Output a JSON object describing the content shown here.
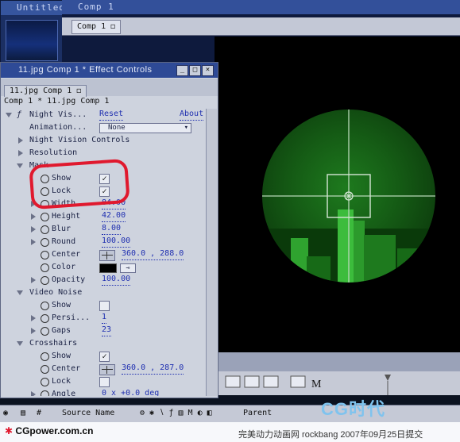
{
  "project": {
    "title": "Untitled"
  },
  "comp_window": {
    "title": "Comp 1",
    "tab_label": "Comp 1"
  },
  "effect_controls": {
    "title": "11.jpg Comp 1 * Effect Controls",
    "tab_label": "11.jpg Comp 1",
    "subtitle": "Comp 1 * 11.jpg Comp 1",
    "effect_name": "Night Vis...",
    "reset_label": "Reset",
    "about_label": "About",
    "animation_label": "Animation...",
    "animation_value": "None",
    "rows": [
      {
        "label": "Night Vision Controls"
      },
      {
        "label": "Resolution"
      },
      {
        "label": "Mask"
      },
      {
        "label": "Show"
      },
      {
        "label": "Lock"
      },
      {
        "label": "Width",
        "value": "84.00"
      },
      {
        "label": "Height",
        "value": "42.00"
      },
      {
        "label": "Blur",
        "value": "8.00"
      },
      {
        "label": "Round",
        "value": "100.00"
      },
      {
        "label": "Center",
        "value": "360.0 , 288.0"
      },
      {
        "label": "Color"
      },
      {
        "label": "Opacity",
        "value": "100.00"
      },
      {
        "label": "Video Noise"
      },
      {
        "label": "Show"
      },
      {
        "label": "Persi...",
        "value": "1"
      },
      {
        "label": "Gaps",
        "value": "23"
      },
      {
        "label": "Crosshairs"
      },
      {
        "label": "Show"
      },
      {
        "label": "Center",
        "value": "360.0 , 287.0"
      },
      {
        "label": "Lock"
      },
      {
        "label": "Angle",
        "value": "0 x +0.0 deg"
      }
    ]
  },
  "timeline": {
    "source_name_header": "Source Name",
    "parent_header": "Parent",
    "hash_header": "#"
  },
  "footer": {
    "left_logo": "CGpower.com.cn",
    "right_text": "完美动力动画网 rockbang 2007年09月25日提交",
    "watermark": "CG时代"
  }
}
